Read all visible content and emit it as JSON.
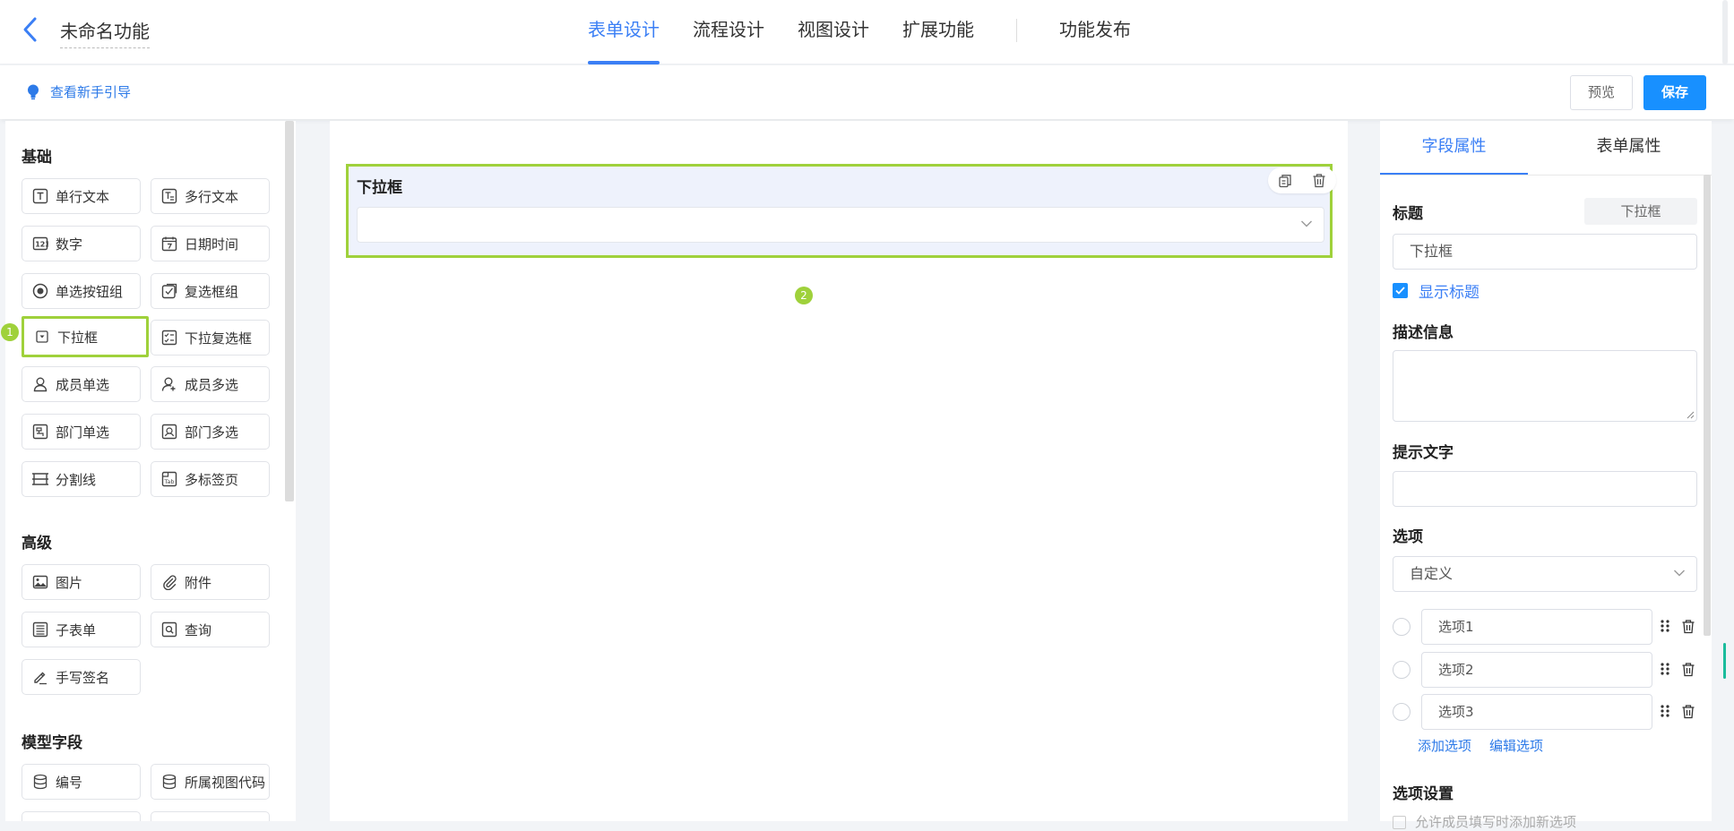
{
  "header": {
    "title": "未命名功能",
    "tabs": [
      {
        "label": "表单设计",
        "active": true
      },
      {
        "label": "流程设计",
        "active": false
      },
      {
        "label": "视图设计",
        "active": false
      },
      {
        "label": "扩展功能",
        "active": false
      },
      {
        "label": "功能发布",
        "active": false
      }
    ]
  },
  "toolbar": {
    "guide_label": "查看新手引导",
    "preview_label": "预览",
    "save_label": "保存"
  },
  "palette": {
    "groups": [
      {
        "title": "基础",
        "items": [
          {
            "label": "单行文本",
            "icon": "text-icon"
          },
          {
            "label": "多行文本",
            "icon": "multiline-text-icon"
          },
          {
            "label": "数字",
            "icon": "number-icon"
          },
          {
            "label": "日期时间",
            "icon": "calendar-icon"
          },
          {
            "label": "单选按钮组",
            "icon": "radio-icon"
          },
          {
            "label": "复选框组",
            "icon": "checkbox-icon"
          },
          {
            "label": "下拉框",
            "icon": "dropdown-icon",
            "selected": true
          },
          {
            "label": "下拉复选框",
            "icon": "dropdown-checkbox-icon"
          },
          {
            "label": "成员单选",
            "icon": "user-icon"
          },
          {
            "label": "成员多选",
            "icon": "users-icon"
          },
          {
            "label": "部门单选",
            "icon": "department-icon"
          },
          {
            "label": "部门多选",
            "icon": "departments-icon"
          },
          {
            "label": "分割线",
            "icon": "divider-icon"
          },
          {
            "label": "多标签页",
            "icon": "tabs-icon"
          }
        ]
      },
      {
        "title": "高级",
        "items": [
          {
            "label": "图片",
            "icon": "image-icon"
          },
          {
            "label": "附件",
            "icon": "paperclip-icon"
          },
          {
            "label": "子表单",
            "icon": "subform-icon"
          },
          {
            "label": "查询",
            "icon": "query-icon"
          },
          {
            "label": "手写签名",
            "icon": "signature-icon"
          }
        ]
      },
      {
        "title": "模型字段",
        "items": [
          {
            "label": "编号",
            "icon": "database-icon"
          },
          {
            "label": "所属视图代码",
            "icon": "database-icon"
          }
        ]
      }
    ]
  },
  "steps": {
    "one": "1",
    "two": "2"
  },
  "canvas": {
    "field": {
      "label": "下拉框",
      "value": ""
    }
  },
  "properties": {
    "tabs": [
      {
        "label": "字段属性",
        "active": true
      },
      {
        "label": "表单属性",
        "active": false
      }
    ],
    "title_label": "标题",
    "type_badge": "下拉框",
    "title_value": "下拉框",
    "show_title_label": "显示标题",
    "show_title_checked": true,
    "description_label": "描述信息",
    "description_value": "",
    "placeholder_label": "提示文字",
    "placeholder_value": "",
    "options_label": "选项",
    "options_source": "自定义",
    "options": [
      "选项1",
      "选项2",
      "选项3"
    ],
    "add_option_label": "添加选项",
    "edit_options_label": "编辑选项",
    "option_settings_label": "选项设置",
    "allow_add_label": "允许成员填写时添加新选项"
  },
  "colors": {
    "accent": "#3b7ff5",
    "primary_button": "#1890ff",
    "highlight": "#9fd13b",
    "field_bg": "#eef2fc"
  }
}
